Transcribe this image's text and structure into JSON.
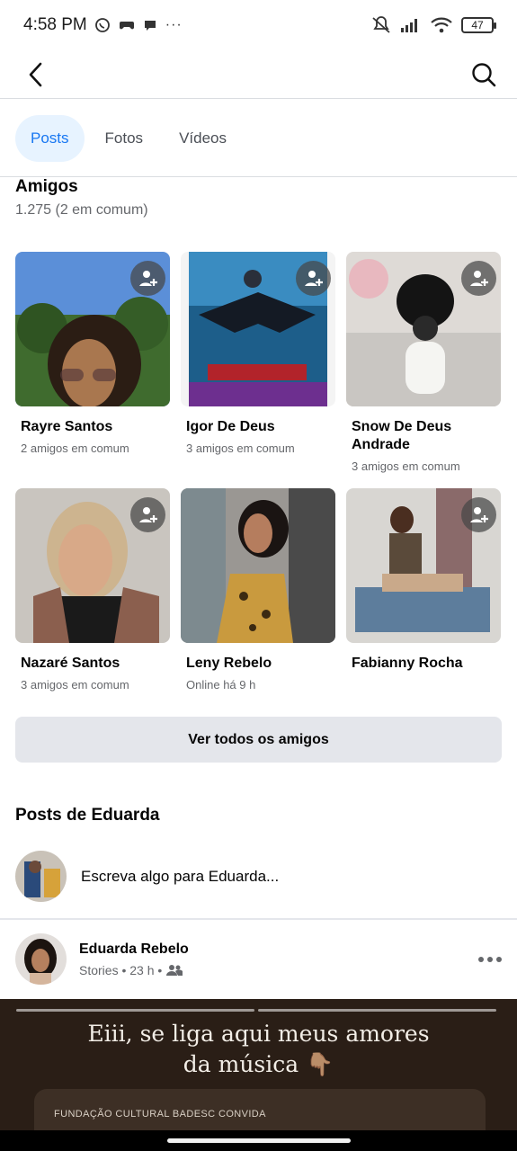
{
  "status_bar": {
    "time": "4:58 PM",
    "battery": "47"
  },
  "tabs": [
    {
      "label": "Posts",
      "active": true
    },
    {
      "label": "Fotos",
      "active": false
    },
    {
      "label": "Vídeos",
      "active": false
    }
  ],
  "friends": {
    "title": "Amigos",
    "count": "1.275 (2 em comum)",
    "items": [
      {
        "name": "Rayre Santos",
        "subtitle": "2 amigos em comum"
      },
      {
        "name": "Igor De Deus",
        "subtitle": "3 amigos em comum"
      },
      {
        "name": "Snow De Deus Andrade",
        "subtitle": "3 amigos em comum"
      },
      {
        "name": "Nazaré Santos",
        "subtitle": "3 amigos em comum"
      },
      {
        "name": "Leny Rebelo",
        "subtitle": "Online há 9 h"
      },
      {
        "name": "Fabianny Rocha",
        "subtitle": ""
      }
    ],
    "see_all": "Ver todos os amigos"
  },
  "posts": {
    "title": "Posts de Eduarda",
    "composer_placeholder": "Escreva algo para Eduarda..."
  },
  "post": {
    "author": "Eduarda Rebelo",
    "meta": "Stories • 23 h •",
    "story_text_line1": "Eiii, se liga aqui meus amores",
    "story_text_line2": "da música 👇🏽",
    "story_card_text": "FUNDAÇÃO CULTURAL BADESC CONVIDA"
  },
  "colors": {
    "accent": "#1877f2",
    "tab_active_bg": "#e7f3ff",
    "button_bg": "#e4e6eb",
    "secondary_text": "#65676b"
  }
}
